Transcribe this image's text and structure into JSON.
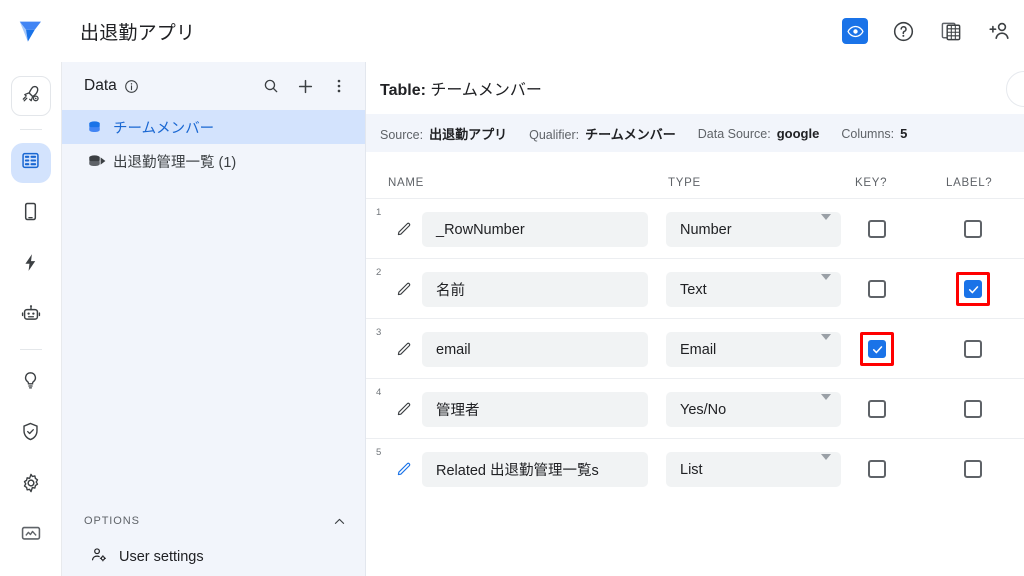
{
  "topbar": {
    "app_title": "出退勤アプリ",
    "logo_name": "appsheet-logo",
    "actions": [
      {
        "name": "preview-eye-button",
        "icon": "eye-icon",
        "active": true
      },
      {
        "name": "help-button",
        "icon": "question-circle-icon",
        "active": false
      },
      {
        "name": "spreadsheet-button",
        "icon": "grid-table-icon",
        "active": false
      },
      {
        "name": "share-add-user-button",
        "icon": "person-add-icon",
        "active": false
      }
    ]
  },
  "rail": {
    "items": [
      {
        "name": "rail-item-deploy",
        "icon": "rocket-icon",
        "active": false,
        "boxed": true
      },
      {
        "name": "rail-item-data",
        "icon": "database-rows-icon",
        "active": true,
        "boxed": false
      },
      {
        "name": "rail-item-app",
        "icon": "mobile-phone-icon",
        "active": false,
        "boxed": false
      },
      {
        "name": "rail-item-automation",
        "icon": "lightning-bolt-icon",
        "active": false,
        "boxed": false
      },
      {
        "name": "rail-item-intelligence",
        "icon": "robot-icon",
        "active": false,
        "boxed": false
      },
      {
        "name": "rail-item-ideas",
        "icon": "lightbulb-icon",
        "active": false,
        "boxed": false
      },
      {
        "name": "rail-item-security",
        "icon": "shield-icon",
        "active": false,
        "boxed": false
      },
      {
        "name": "rail-item-settings",
        "icon": "gear-icon",
        "active": false,
        "boxed": false
      },
      {
        "name": "rail-item-monitor",
        "icon": "monitor-icon",
        "active": false,
        "boxed": false
      }
    ]
  },
  "data_panel": {
    "title": "Data",
    "info_icon": "info-circle-icon",
    "actions": [
      {
        "name": "search-tables-button",
        "icon": "search-icon"
      },
      {
        "name": "add-table-button",
        "icon": "plus-icon"
      },
      {
        "name": "table-overflow-menu-button",
        "icon": "kebab-menu-icon"
      }
    ],
    "tables": [
      {
        "label": "チームメンバー",
        "selected": true,
        "expandable": false
      },
      {
        "label": "出退勤管理一覧 (1)",
        "selected": false,
        "expandable": true
      }
    ],
    "options": {
      "header": "OPTIONS",
      "chevron": "chevron-up-icon",
      "items": [
        {
          "label": "User settings",
          "icon": "person-gear-icon"
        }
      ]
    }
  },
  "main": {
    "title_prefix": "Table:",
    "title_value": "チームメンバー",
    "meta": [
      {
        "key": "Source:",
        "value": "出退勤アプリ"
      },
      {
        "key": "Qualifier:",
        "value": "チームメンバー"
      },
      {
        "key": "Data Source:",
        "value": "google"
      },
      {
        "key": "Columns:",
        "value": "5"
      }
    ],
    "columns": {
      "name": "NAME",
      "type": "TYPE",
      "key": "KEY?",
      "label": "LABEL?"
    },
    "rows": [
      {
        "num": "1",
        "name": "_RowNumber",
        "type": "Number",
        "key_checked": false,
        "label_checked": false,
        "key_annotated": false,
        "label_annotated": false,
        "virtual": false
      },
      {
        "num": "2",
        "name": "名前",
        "type": "Text",
        "key_checked": false,
        "label_checked": true,
        "key_annotated": false,
        "label_annotated": true,
        "virtual": false
      },
      {
        "num": "3",
        "name": "email",
        "type": "Email",
        "key_checked": true,
        "label_checked": false,
        "key_annotated": true,
        "label_annotated": false,
        "virtual": false
      },
      {
        "num": "4",
        "name": "管理者",
        "type": "Yes/No",
        "key_checked": false,
        "label_checked": false,
        "key_annotated": false,
        "label_annotated": false,
        "virtual": false
      },
      {
        "num": "5",
        "name": "Related 出退勤管理一覧s",
        "type": "List",
        "key_checked": false,
        "label_checked": false,
        "key_annotated": false,
        "label_annotated": false,
        "virtual": true
      }
    ]
  },
  "colors": {
    "accent_blue": "#1a73e8",
    "selected_row_bg": "#d3e3fd",
    "panel_bg": "#f2f5fb",
    "field_bg": "#f1f3f4",
    "annotation_red": "#ff0000",
    "text_primary": "#202124",
    "text_secondary": "#5f6368"
  }
}
